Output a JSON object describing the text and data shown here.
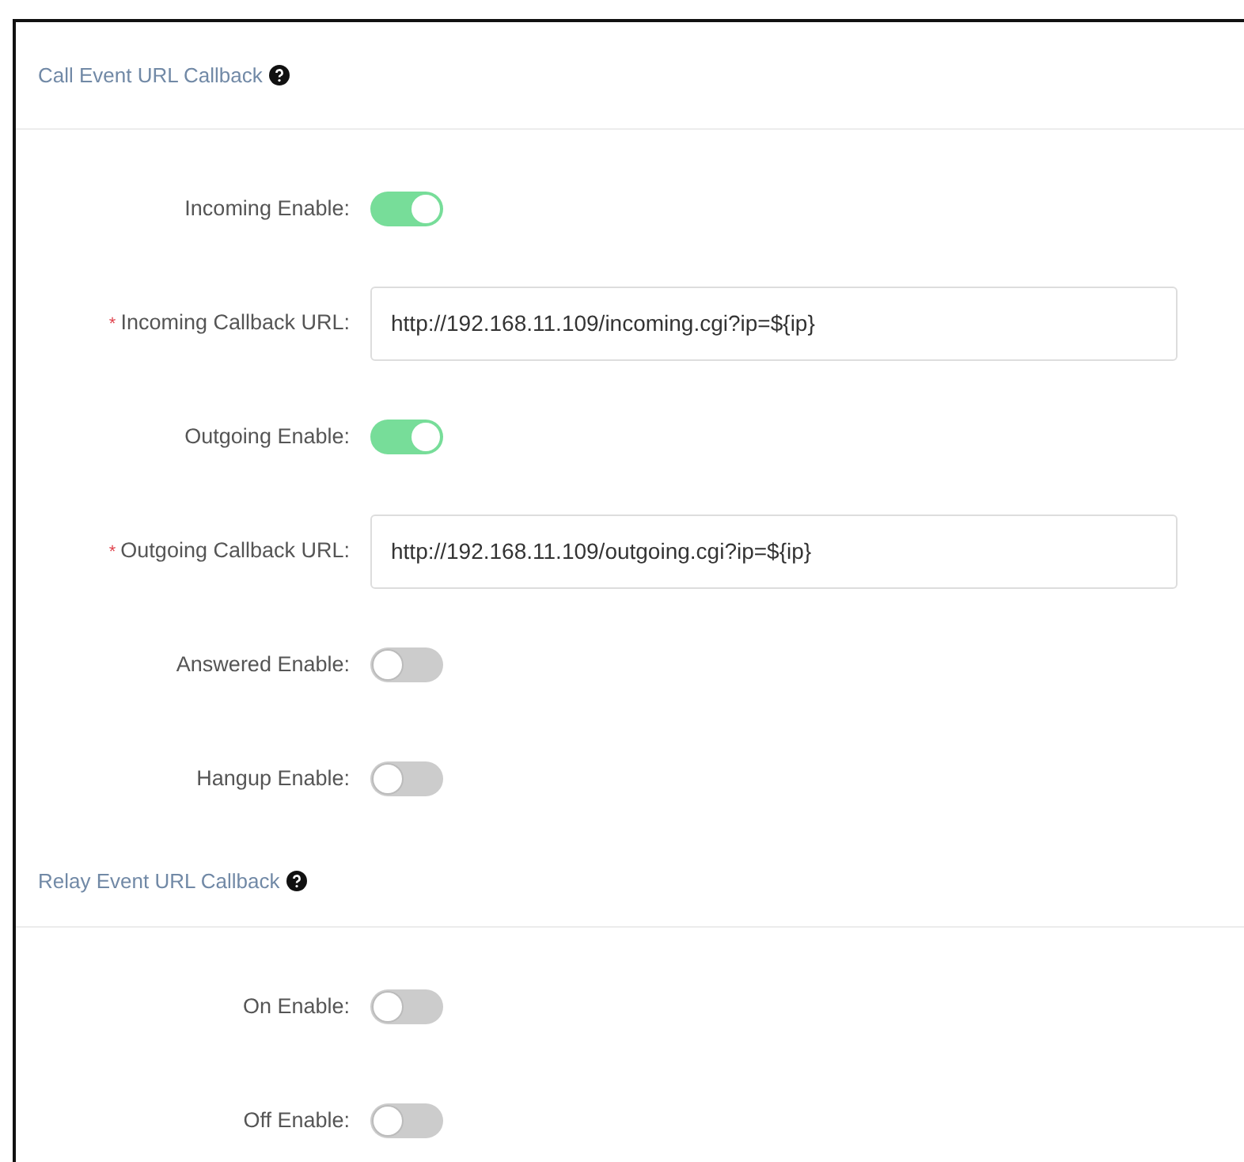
{
  "sections": [
    {
      "title": "Call Event URL Callback",
      "fields": [
        {
          "kind": "switch",
          "label": "Incoming Enable:",
          "on": true
        },
        {
          "kind": "url",
          "label": "Incoming Callback URL:",
          "required_mark": "*",
          "value": "http://192.168.11.109/incoming.cgi?ip=${ip}"
        },
        {
          "kind": "switch",
          "label": "Outgoing Enable:",
          "on": true
        },
        {
          "kind": "url",
          "label": "Outgoing Callback URL:",
          "required_mark": "*",
          "value": "http://192.168.11.109/outgoing.cgi?ip=${ip}"
        },
        {
          "kind": "switch",
          "label": "Answered Enable:",
          "on": false
        },
        {
          "kind": "switch",
          "label": "Hangup Enable:",
          "on": false
        }
      ]
    },
    {
      "title": "Relay Event URL Callback",
      "fields": [
        {
          "kind": "switch",
          "label": "On Enable:",
          "on": false
        },
        {
          "kind": "switch",
          "label": "Off Enable:",
          "on": false
        }
      ]
    }
  ]
}
